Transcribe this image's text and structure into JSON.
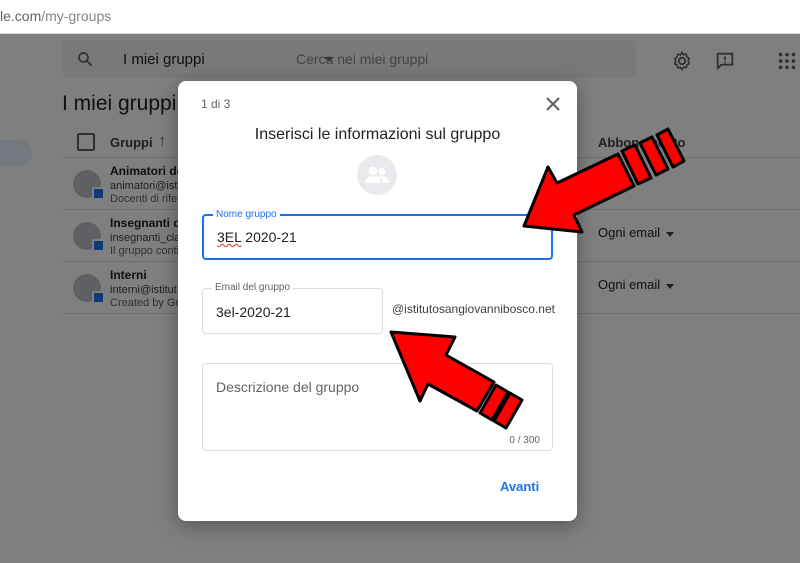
{
  "browser": {
    "url_host": "le.com",
    "url_path": "/my-groups"
  },
  "header": {
    "search_scope": "I miei gruppi",
    "search_placeholder": "Cerca nei miei gruppi",
    "icons": [
      "search-icon",
      "gear-icon",
      "feedback-icon",
      "apps-grid-icon"
    ]
  },
  "page": {
    "title": "I miei gruppi",
    "columns": {
      "groups": "Gruppi",
      "subscription": "Abbonamento"
    },
    "rows": [
      {
        "name": "Animatori del",
        "email": "animatori@ist",
        "desc": "Docenti di rifer",
        "subscription": ""
      },
      {
        "name": "Insegnanti di",
        "email": "insegnanti_cla",
        "desc": "Il gruppo conti",
        "subscription": "Ogni email"
      },
      {
        "name": "Interni",
        "email": "interni@istitut",
        "desc": "Created by Ger",
        "subscription": "Ogni email"
      }
    ]
  },
  "dialog": {
    "step": "1 di 3",
    "title": "Inserisci le informazioni sul gruppo",
    "name_field": {
      "label": "Nome gruppo",
      "value_part1": "3EL",
      "value_part2": " 2020-21"
    },
    "email_field": {
      "label": "Email del gruppo",
      "value": "3el-2020-21",
      "domain": "@istitutosangiovannibosco.net"
    },
    "description_field": {
      "placeholder": "Descrizione del gruppo",
      "counter": "0 / 300"
    },
    "next_button": "Avanti"
  },
  "colors": {
    "accent": "#1a73e8",
    "annotation": "#ff0000"
  }
}
